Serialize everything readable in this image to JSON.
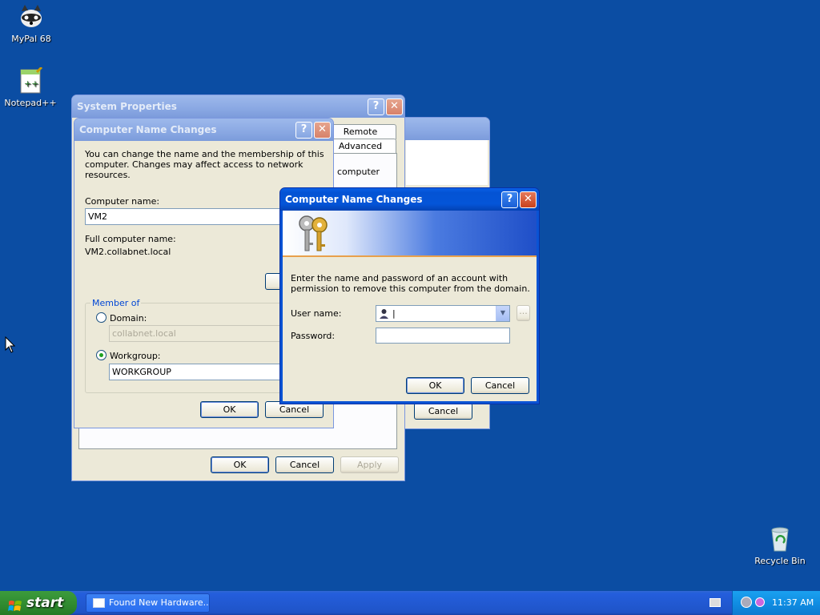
{
  "desktop": {
    "icons": [
      {
        "label": "MyPal 68"
      },
      {
        "label": "Notepad++"
      },
      {
        "label": "Recycle Bin"
      }
    ]
  },
  "system_properties": {
    "title": "System Properties",
    "tabs": [
      "Remote",
      "Advanced"
    ],
    "partial_text": "computer",
    "ok": "OK",
    "cancel": "Cancel",
    "apply": "Apply"
  },
  "back_window": {
    "cancel": "Cancel"
  },
  "computer_name_changes": {
    "title": "Computer Name Changes",
    "intro": "You can change the name and the membership of this computer. Changes may affect access to network resources.",
    "computer_name_label": "Computer name:",
    "computer_name_value": "VM2",
    "full_name_label": "Full computer name:",
    "full_name_value": "VM2.collabnet.local",
    "member_of": "Member of",
    "domain_label": "Domain:",
    "domain_value": "collabnet.local",
    "workgroup_label": "Workgroup:",
    "workgroup_value": "WORKGROUP",
    "ok": "OK",
    "cancel": "Cancel"
  },
  "credentials": {
    "title": "Computer Name Changes",
    "message": "Enter the name and password of an account with permission to remove this computer from the domain.",
    "username_label": "User name:",
    "username_value": "|",
    "browse": "...",
    "password_label": "Password:",
    "password_value": "",
    "ok": "OK",
    "cancel": "Cancel"
  },
  "taskbar": {
    "start": "start",
    "task_label": "Found New Hardware...",
    "clock": "11:37 AM"
  }
}
